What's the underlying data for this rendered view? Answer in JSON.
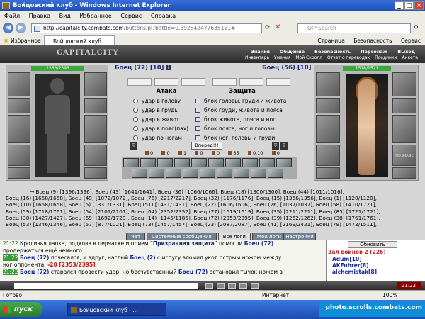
{
  "window": {
    "title": "Бойцовский клуб - Windows Internet Explorer"
  },
  "menubar": [
    "Файл",
    "Правка",
    "Вид",
    "Избранное",
    "Сервис",
    "Справка"
  ],
  "address": {
    "host": "http://capitalcity.combats.com",
    "rest": "/buttons.pl?battle=0.392842477635121#",
    "search_placeholder": "QIP Search"
  },
  "favbar": {
    "favorites": "Избранное",
    "tab": "Бойцовский клуб",
    "tools": [
      "Страница",
      "Безопасность",
      "Сервис"
    ]
  },
  "game": {
    "logo": "CAPITALCITY",
    "menu1": [
      "Знания",
      "Общение",
      "Безопасность",
      "Персонаж",
      "Выход"
    ],
    "menu2": [
      "Инвентарь",
      "Умения",
      "Мой Скролл",
      "Отчет о переводах",
      "Поединки",
      "Анкета"
    ],
    "left": {
      "hp": "2353/2395",
      "name": "Боец (72)",
      "level": "[10]"
    },
    "right": {
      "hp": "1518/1521",
      "name": "Боец (56)",
      "level": "[10]",
      "noimage": "NO IMAGE"
    }
  },
  "combat": {
    "attack_label": "Атака",
    "defense_label": "Защита",
    "attacks": [
      "удар в голову",
      "удар в грудь",
      "удар в живот",
      "удар в пояс(пах)",
      "удар по ногам"
    ],
    "defenses": [
      "блок головы, груди и живота",
      "блок груди, живота и пояса",
      "блок живота, пояса и ног",
      "блок пояса, ног и головы",
      "блок ног, головы и груди"
    ],
    "forward": "Вперед!!!",
    "stats": [
      "0",
      "0",
      "1",
      "0",
      "0",
      "35",
      "0.10",
      "0"
    ]
  },
  "fighters": [
    "→ Боец (9) [1396/1396], Боец (43) [1641/1641], Боец (36) [1066/1066], Боец (18) [1300/1300], Боец (44) [1011/1016],",
    "Боец (16) [1658/1658], Боец (49) [1072/1072], Боец (76) [2217/2217], Боец (32) [1176/1176], Боец (15) [1356/1356], Боец (1) [1120/1120],",
    "Боец (10) [1658/1658], Боец (5) [1331/1331], Боец (51) [1431/1431], Боец (22) [1606/1606], Боец (26) [1037/1037], Боец (58) [1410/1721],",
    "Боец (59) [1718/1761], Боец (54) [2101/2101], Боец (64) [2352/2352], Боец (77) [1619/1619], Боец (35) [2211/2211], Боец (85) [1721/1721],",
    "Боец (30) [1427/1427], Боец (69) [1692/1729], Боец (14) [1145/1186], Боец (72) [2353/2395], Боец (39) [1262/1262], Боец (38) [1761/1761],",
    "Боец (53) [1346/1346], Боец (57) [877/1021], Боец (73) [1457/1457], Боец (23) [2087/2087], Боец (41) [2169/2421], Боец (79) [1473/1511],"
  ],
  "chattabs": [
    "Чат",
    "Системные сообщения",
    "Все логи",
    "Мои логи",
    "Настройки"
  ],
  "chat": {
    "l1_time": "21:22",
    "l1_a": "Кроличья лапка, подкова в перчатке и прием ",
    "l1_q": "\"Призрачная защита\"",
    "l1_b": " помогли ",
    "l1_n": "Боец (72)",
    "l1_c": "продержаться ещё немного.",
    "l2_time": "21:22",
    "l2_n1": "Боец (72)",
    "l2_a": " почесался, и вдруг, наглый ",
    "l2_n2": "Боец (2)",
    "l2_b": " с испугу вломил укол острым ножом между",
    "l2_c": "ног оппонента.",
    "l2_d": " -20 [2353/2395]",
    "l3_time": "21:22",
    "l3_n1": "Боец (72)",
    "l3_a": " старался провести удар, но бесчувственный ",
    "l3_n2": "Боец (72)",
    "l3_b": " остановил тычок ножом в"
  },
  "side": {
    "update": "Обновить",
    "hall": "Зал воинов 2 (226)",
    "u1": "Adum[10]",
    "u2": "AKFuhrer[8]",
    "u3": "alchemistak[8]"
  },
  "clock": "21:22",
  "status": {
    "left": "Готово",
    "zone": "Интернет",
    "zoom": "100%"
  },
  "taskbar": {
    "start": "пуск",
    "item": "Бойцовский клуб - ...",
    "watermark": "photo.scrolls.combats.com"
  }
}
